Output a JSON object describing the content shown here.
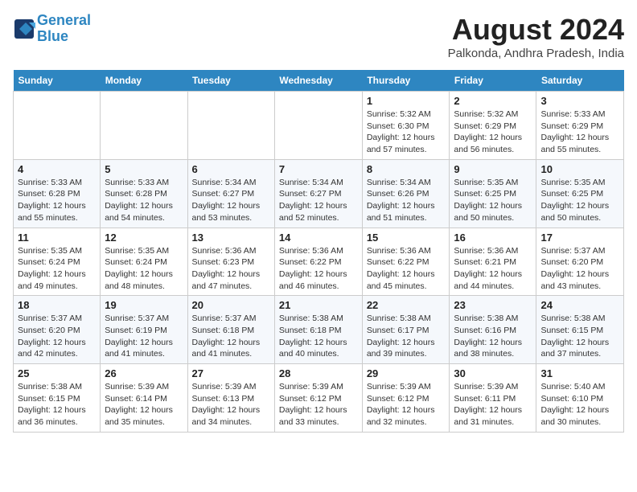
{
  "header": {
    "logo_line1": "General",
    "logo_line2": "Blue",
    "month_year": "August 2024",
    "location": "Palkonda, Andhra Pradesh, India"
  },
  "weekdays": [
    "Sunday",
    "Monday",
    "Tuesday",
    "Wednesday",
    "Thursday",
    "Friday",
    "Saturday"
  ],
  "weeks": [
    [
      {
        "day": "",
        "info": ""
      },
      {
        "day": "",
        "info": ""
      },
      {
        "day": "",
        "info": ""
      },
      {
        "day": "",
        "info": ""
      },
      {
        "day": "1",
        "info": "Sunrise: 5:32 AM\nSunset: 6:30 PM\nDaylight: 12 hours\nand 57 minutes."
      },
      {
        "day": "2",
        "info": "Sunrise: 5:32 AM\nSunset: 6:29 PM\nDaylight: 12 hours\nand 56 minutes."
      },
      {
        "day": "3",
        "info": "Sunrise: 5:33 AM\nSunset: 6:29 PM\nDaylight: 12 hours\nand 55 minutes."
      }
    ],
    [
      {
        "day": "4",
        "info": "Sunrise: 5:33 AM\nSunset: 6:28 PM\nDaylight: 12 hours\nand 55 minutes."
      },
      {
        "day": "5",
        "info": "Sunrise: 5:33 AM\nSunset: 6:28 PM\nDaylight: 12 hours\nand 54 minutes."
      },
      {
        "day": "6",
        "info": "Sunrise: 5:34 AM\nSunset: 6:27 PM\nDaylight: 12 hours\nand 53 minutes."
      },
      {
        "day": "7",
        "info": "Sunrise: 5:34 AM\nSunset: 6:27 PM\nDaylight: 12 hours\nand 52 minutes."
      },
      {
        "day": "8",
        "info": "Sunrise: 5:34 AM\nSunset: 6:26 PM\nDaylight: 12 hours\nand 51 minutes."
      },
      {
        "day": "9",
        "info": "Sunrise: 5:35 AM\nSunset: 6:25 PM\nDaylight: 12 hours\nand 50 minutes."
      },
      {
        "day": "10",
        "info": "Sunrise: 5:35 AM\nSunset: 6:25 PM\nDaylight: 12 hours\nand 50 minutes."
      }
    ],
    [
      {
        "day": "11",
        "info": "Sunrise: 5:35 AM\nSunset: 6:24 PM\nDaylight: 12 hours\nand 49 minutes."
      },
      {
        "day": "12",
        "info": "Sunrise: 5:35 AM\nSunset: 6:24 PM\nDaylight: 12 hours\nand 48 minutes."
      },
      {
        "day": "13",
        "info": "Sunrise: 5:36 AM\nSunset: 6:23 PM\nDaylight: 12 hours\nand 47 minutes."
      },
      {
        "day": "14",
        "info": "Sunrise: 5:36 AM\nSunset: 6:22 PM\nDaylight: 12 hours\nand 46 minutes."
      },
      {
        "day": "15",
        "info": "Sunrise: 5:36 AM\nSunset: 6:22 PM\nDaylight: 12 hours\nand 45 minutes."
      },
      {
        "day": "16",
        "info": "Sunrise: 5:36 AM\nSunset: 6:21 PM\nDaylight: 12 hours\nand 44 minutes."
      },
      {
        "day": "17",
        "info": "Sunrise: 5:37 AM\nSunset: 6:20 PM\nDaylight: 12 hours\nand 43 minutes."
      }
    ],
    [
      {
        "day": "18",
        "info": "Sunrise: 5:37 AM\nSunset: 6:20 PM\nDaylight: 12 hours\nand 42 minutes."
      },
      {
        "day": "19",
        "info": "Sunrise: 5:37 AM\nSunset: 6:19 PM\nDaylight: 12 hours\nand 41 minutes."
      },
      {
        "day": "20",
        "info": "Sunrise: 5:37 AM\nSunset: 6:18 PM\nDaylight: 12 hours\nand 41 minutes."
      },
      {
        "day": "21",
        "info": "Sunrise: 5:38 AM\nSunset: 6:18 PM\nDaylight: 12 hours\nand 40 minutes."
      },
      {
        "day": "22",
        "info": "Sunrise: 5:38 AM\nSunset: 6:17 PM\nDaylight: 12 hours\nand 39 minutes."
      },
      {
        "day": "23",
        "info": "Sunrise: 5:38 AM\nSunset: 6:16 PM\nDaylight: 12 hours\nand 38 minutes."
      },
      {
        "day": "24",
        "info": "Sunrise: 5:38 AM\nSunset: 6:15 PM\nDaylight: 12 hours\nand 37 minutes."
      }
    ],
    [
      {
        "day": "25",
        "info": "Sunrise: 5:38 AM\nSunset: 6:15 PM\nDaylight: 12 hours\nand 36 minutes."
      },
      {
        "day": "26",
        "info": "Sunrise: 5:39 AM\nSunset: 6:14 PM\nDaylight: 12 hours\nand 35 minutes."
      },
      {
        "day": "27",
        "info": "Sunrise: 5:39 AM\nSunset: 6:13 PM\nDaylight: 12 hours\nand 34 minutes."
      },
      {
        "day": "28",
        "info": "Sunrise: 5:39 AM\nSunset: 6:12 PM\nDaylight: 12 hours\nand 33 minutes."
      },
      {
        "day": "29",
        "info": "Sunrise: 5:39 AM\nSunset: 6:12 PM\nDaylight: 12 hours\nand 32 minutes."
      },
      {
        "day": "30",
        "info": "Sunrise: 5:39 AM\nSunset: 6:11 PM\nDaylight: 12 hours\nand 31 minutes."
      },
      {
        "day": "31",
        "info": "Sunrise: 5:40 AM\nSunset: 6:10 PM\nDaylight: 12 hours\nand 30 minutes."
      }
    ]
  ]
}
